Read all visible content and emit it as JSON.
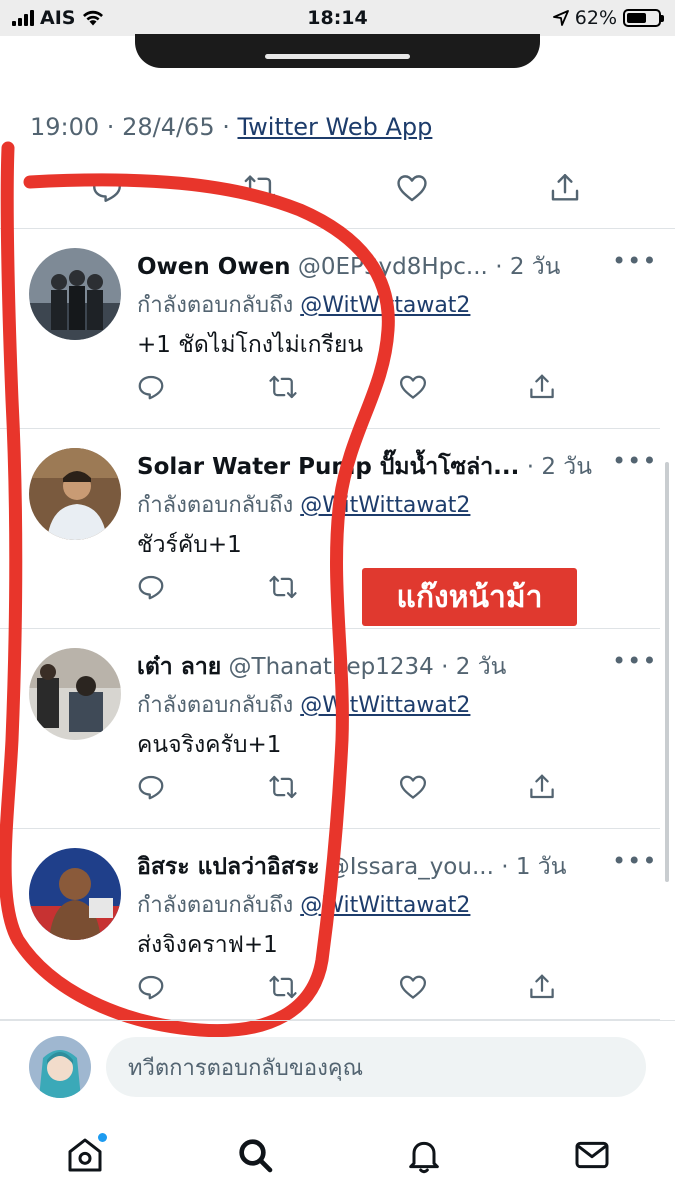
{
  "status_bar": {
    "carrier": "AIS",
    "time": "18:14",
    "battery_percent": "62%",
    "battery_level": 0.62
  },
  "tweet": {
    "time": "19:00",
    "date": "28/4/65",
    "separator": " · ",
    "source": "Twitter Web App"
  },
  "replies": [
    {
      "name": "Owen Owen",
      "handle": "@0EP3yd8Hpc...",
      "age": "2 วัน",
      "replying_label": "กำลังตอบกลับถึง",
      "replying_to": "@WitWittawat2",
      "text": "+1 ชัดไม่โกงไม่เกรียน",
      "has_like": true
    },
    {
      "name": "Solar Water Pump ปั๊มน้ำโซล่า...",
      "handle": "",
      "age": "2 วัน",
      "replying_label": "กำลังตอบกลับถึง",
      "replying_to": "@WitWittawat2",
      "text": "ชัวร์คับ+1",
      "has_like": false
    },
    {
      "name": "เต๋า ลาย",
      "handle": "@Thanathep1234",
      "age": "2 วัน",
      "replying_label": "กำลังตอบกลับถึง",
      "replying_to": "@WitWittawat2",
      "text": "คนจริงครับ+1",
      "has_like": true
    },
    {
      "name": "อิสระ แปลว่าอิสระ",
      "handle": "@Issara_you...",
      "age": "1 วัน",
      "replying_label": "กำลังตอบกลับถึง",
      "replying_to": "@WitWittawat2",
      "text": "ส่งจิงคราฟ+1",
      "has_like": true
    }
  ],
  "more_label": "•••",
  "overlay_badge": "แก๊งหน้าม้า",
  "compose": {
    "placeholder": "ทวีตการตอบกลับของคุณ"
  },
  "colors": {
    "accent": "#1d9bf0",
    "link": "#1d3c6b",
    "annotation_red": "#e0392f",
    "muted_text": "#536471"
  },
  "icons": {
    "reply": "reply-icon",
    "retweet": "retweet-icon",
    "like": "heart-icon",
    "share": "share-icon",
    "home": "home-icon",
    "search": "search-icon",
    "notifications": "bell-icon",
    "messages": "mail-icon"
  }
}
